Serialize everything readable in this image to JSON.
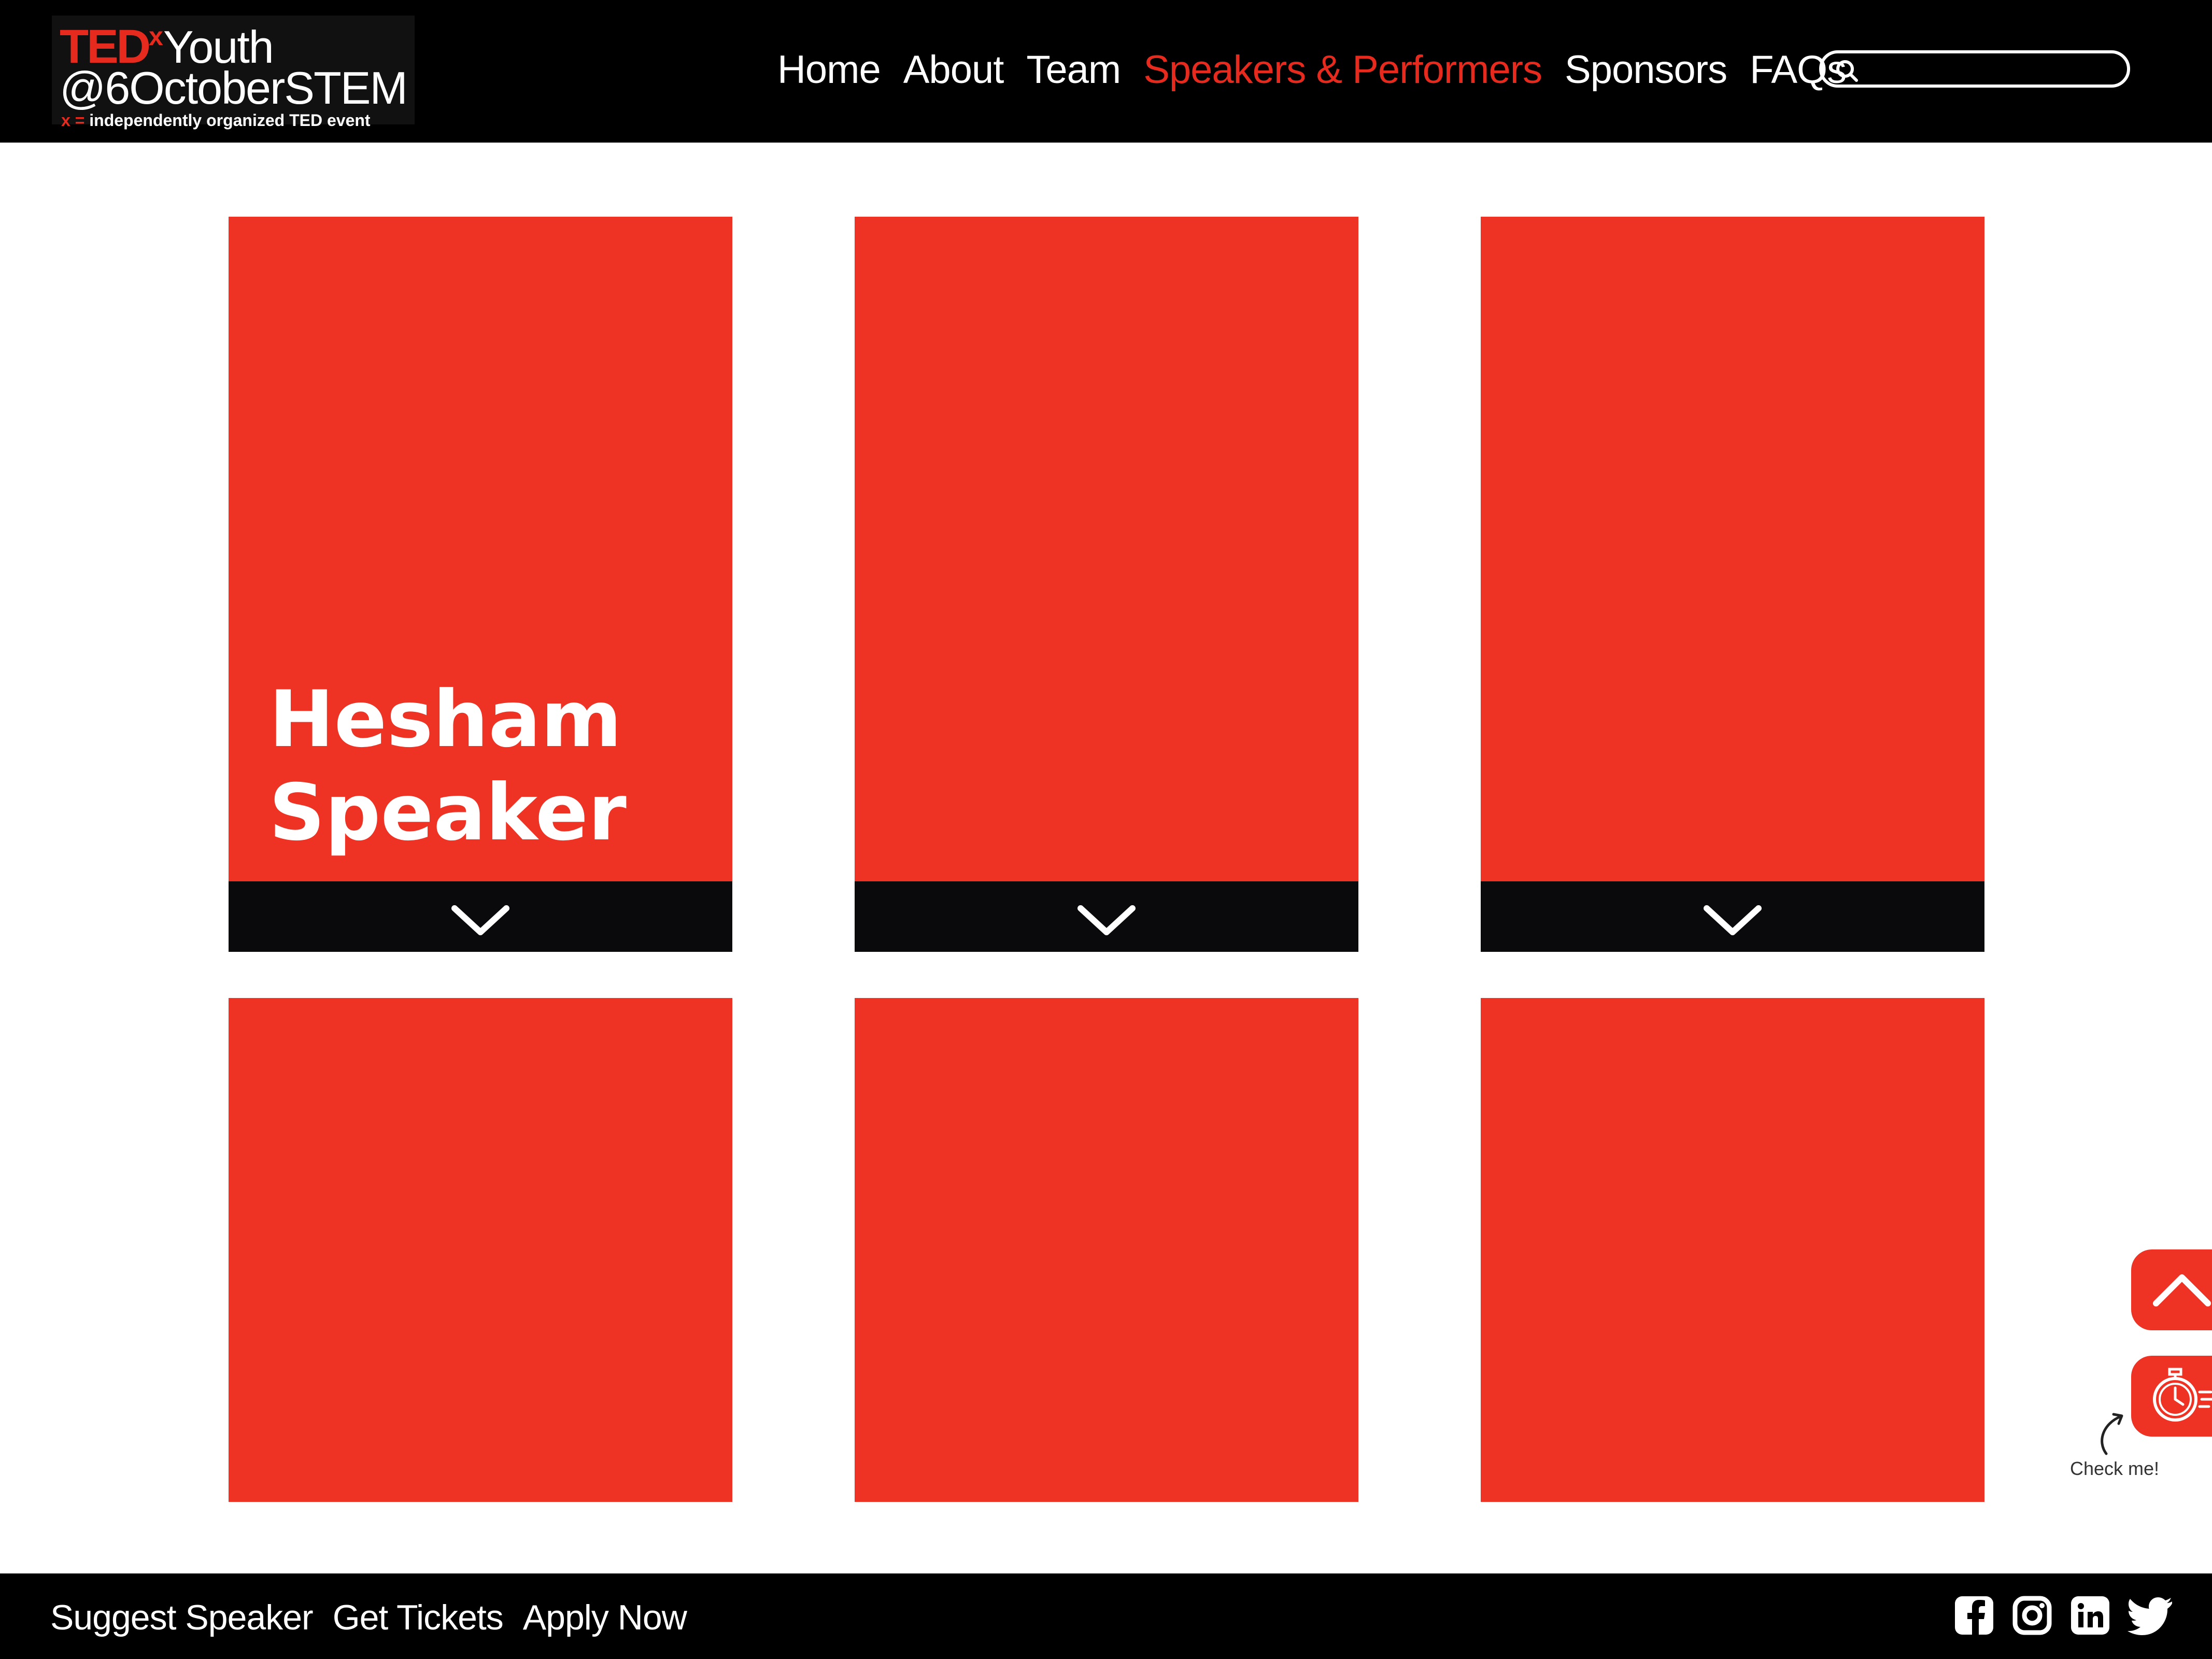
{
  "logo": {
    "ted": "TED",
    "x": "x",
    "youth": "Youth",
    "event": "@6OctoberSTEM",
    "tagline_x": "x",
    "tagline_eq": " = ",
    "tagline": "independently organized TED event"
  },
  "nav": {
    "items": [
      {
        "label": "Home"
      },
      {
        "label": "About"
      },
      {
        "label": "Team"
      },
      {
        "label": "Speakers & Performers",
        "active": true
      },
      {
        "label": "Sponsors"
      },
      {
        "label": "FAQs"
      }
    ]
  },
  "search": {
    "value": "",
    "icon": "search-icon"
  },
  "speakers": {
    "cards": [
      {
        "name": "Hesham Speaker",
        "expand_icon": "chevron-down-icon"
      },
      {
        "name": "",
        "expand_icon": "chevron-down-icon"
      },
      {
        "name": "",
        "expand_icon": "chevron-down-icon"
      },
      {
        "name": ""
      },
      {
        "name": ""
      },
      {
        "name": ""
      }
    ]
  },
  "floating": {
    "scroll_top_icon": "chevron-up-icon",
    "timer_icon": "stopwatch-icon",
    "check_label": "Check me!"
  },
  "footer": {
    "links": [
      {
        "label": "Suggest Speaker"
      },
      {
        "label": "Get Tickets"
      },
      {
        "label": "Apply Now"
      }
    ],
    "social": [
      "facebook-icon",
      "instagram-icon",
      "linkedin-icon",
      "twitter-icon"
    ]
  },
  "colors": {
    "accent": "#ee3325",
    "ted_red": "#e62b1e",
    "header_bg": "#000000",
    "card_bar": "#0a0a0c",
    "background": "#ffffff"
  }
}
